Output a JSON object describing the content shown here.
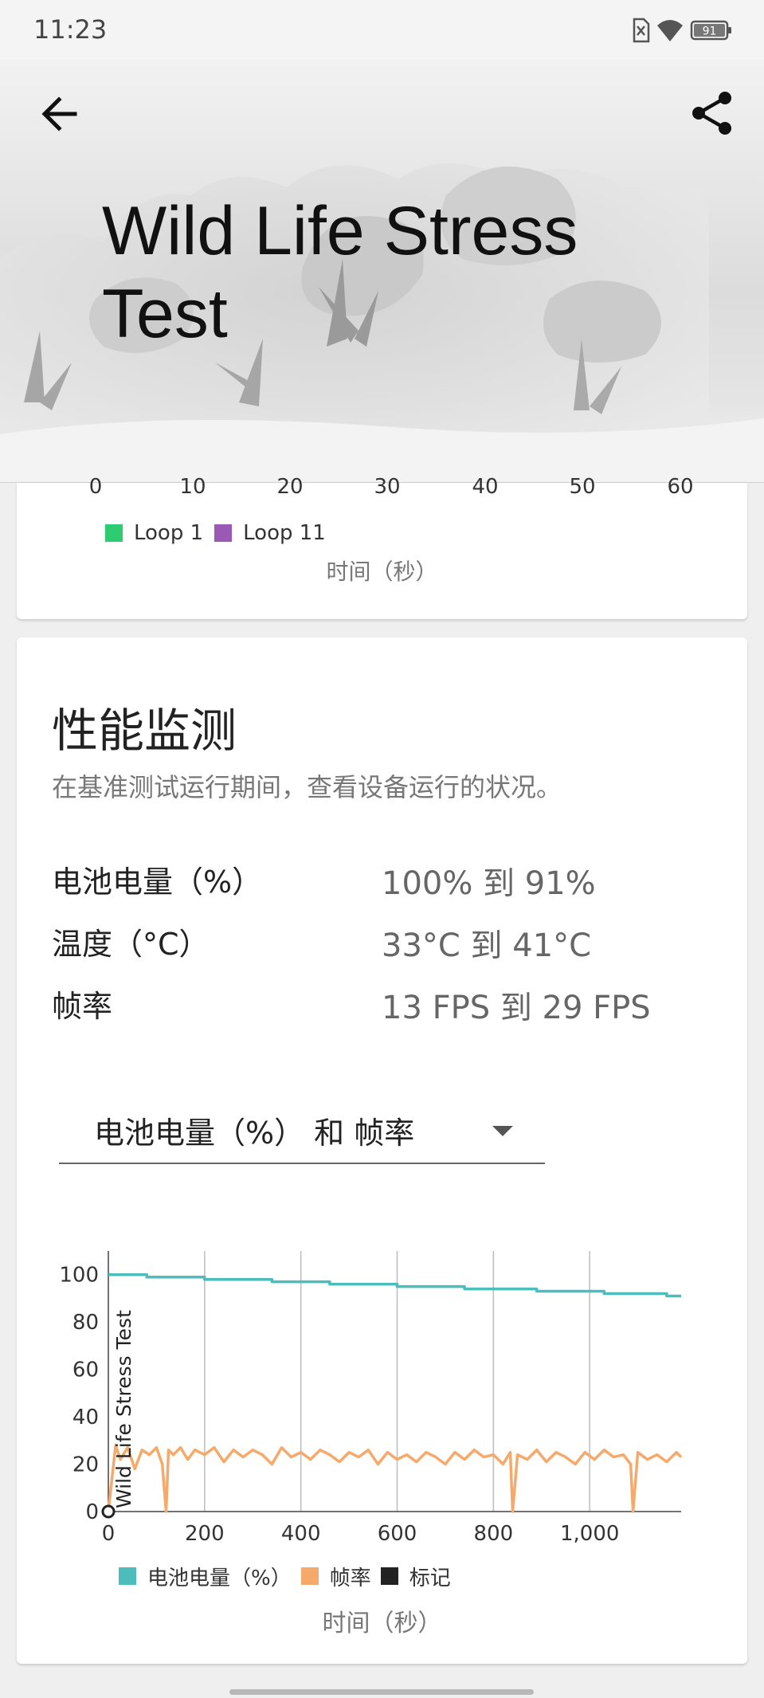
{
  "status": {
    "time": "11:23",
    "battery": "91"
  },
  "header": {
    "title": "Wild Life Stress Test"
  },
  "top_chart": {
    "x_ticks": [
      "0",
      "10",
      "20",
      "30",
      "40",
      "50",
      "60"
    ],
    "legend": [
      {
        "label": "Loop 1",
        "color": "#2ecc71"
      },
      {
        "label": "Loop 11",
        "color": "#9b59b6"
      }
    ],
    "x_title": "时间（秒）"
  },
  "perf": {
    "title": "性能监测",
    "subtitle": "在基准测试运行期间，查看设备运行的状况。",
    "stats": [
      {
        "label": "电池电量（%）",
        "value": "100% 到 91%"
      },
      {
        "label": "温度（°C）",
        "value": "33°C 到 41°C"
      },
      {
        "label": "帧率",
        "value": "13 FPS 到 29 FPS"
      }
    ],
    "selector_value": "电池电量（%） 和 帧率"
  },
  "chart_data": {
    "type": "line",
    "x_label": "时间（秒）",
    "y_ticks": [
      "0",
      "20",
      "40",
      "60",
      "80",
      "100"
    ],
    "x_ticks": [
      "0",
      "200",
      "400",
      "600",
      "800",
      "1,000"
    ],
    "ylim": [
      0,
      110
    ],
    "xlim": [
      0,
      1190
    ],
    "vertical_label": "Wild Life Stress Test",
    "legend": [
      {
        "label": "电池电量（%）",
        "color": "#4dbdbb"
      },
      {
        "label": "帧率",
        "color": "#f5a96b"
      },
      {
        "label": "标记",
        "color": "#222222"
      }
    ],
    "series": [
      {
        "name": "电池电量（%）",
        "color": "#4dbdbb",
        "x": [
          0,
          80,
          80,
          200,
          200,
          340,
          340,
          460,
          460,
          600,
          600,
          740,
          740,
          890,
          890,
          1030,
          1030,
          1160,
          1160,
          1190
        ],
        "y": [
          100,
          100,
          99,
          99,
          98,
          98,
          97,
          97,
          96,
          96,
          95,
          95,
          94,
          94,
          93,
          93,
          92,
          92,
          91,
          91
        ]
      },
      {
        "name": "帧率",
        "color": "#f5a96b",
        "x": [
          0,
          15,
          25,
          40,
          55,
          70,
          85,
          100,
          112,
          120,
          125,
          135,
          150,
          165,
          180,
          200,
          220,
          240,
          260,
          280,
          300,
          320,
          340,
          360,
          380,
          400,
          420,
          440,
          460,
          480,
          500,
          520,
          540,
          560,
          580,
          600,
          620,
          640,
          660,
          680,
          700,
          720,
          740,
          760,
          780,
          800,
          820,
          835,
          840,
          850,
          870,
          890,
          910,
          930,
          950,
          970,
          990,
          1010,
          1030,
          1050,
          1070,
          1085,
          1090,
          1100,
          1120,
          1140,
          1160,
          1180,
          1190
        ],
        "y": [
          0,
          28,
          22,
          27,
          18,
          26,
          24,
          27,
          20,
          0,
          26,
          24,
          27,
          22,
          26,
          24,
          27,
          21,
          26,
          23,
          26,
          24,
          20,
          27,
          23,
          25,
          22,
          26,
          24,
          21,
          25,
          23,
          26,
          20,
          25,
          22,
          24,
          21,
          25,
          23,
          20,
          25,
          22,
          26,
          23,
          24,
          20,
          25,
          0,
          24,
          22,
          26,
          21,
          25,
          23,
          20,
          25,
          22,
          26,
          23,
          24,
          20,
          0,
          25,
          22,
          24,
          21,
          25,
          23
        ]
      }
    ],
    "markers": [
      {
        "x": 0,
        "y": 0
      }
    ]
  }
}
